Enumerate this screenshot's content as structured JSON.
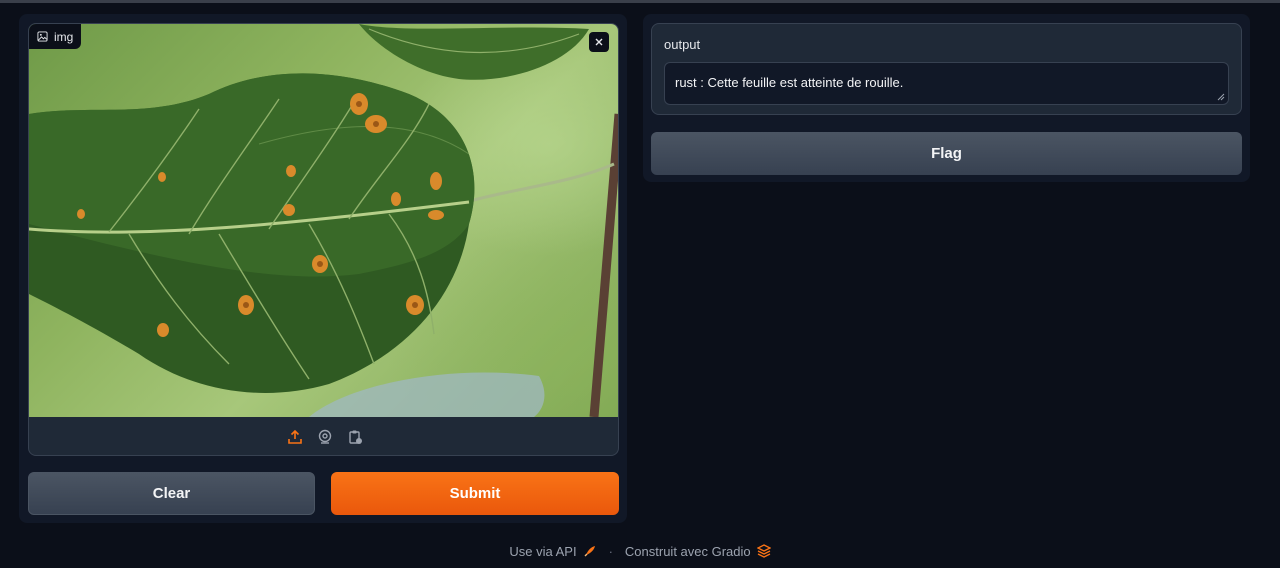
{
  "input": {
    "label": "img",
    "image_description_icon": "image-icon",
    "close_icon": "close-icon",
    "sources": [
      "upload-icon",
      "webcam-icon",
      "clipboard-icon"
    ]
  },
  "buttons": {
    "clear": "Clear",
    "submit": "Submit",
    "flag": "Flag"
  },
  "output": {
    "label": "output",
    "value": "rust : Cette feuille est atteinte de rouille."
  },
  "footer": {
    "api": "Use via API",
    "separator": "·",
    "built_with": "Construit avec Gradio"
  },
  "colors": {
    "accent": "#f97316",
    "background": "#0b0f19",
    "panel": "#111827"
  }
}
